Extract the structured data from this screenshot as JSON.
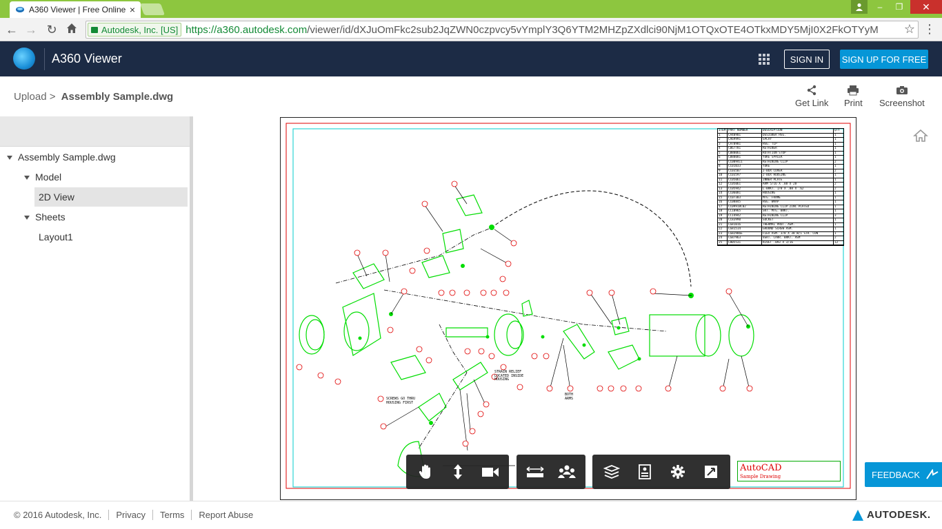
{
  "browser": {
    "tab_title": "A360 Viewer | Free Online",
    "tab_close": "×",
    "ev_label": "Autodesk, Inc. [US]",
    "url_host": "https://a360.autodesk.com",
    "url_path": "/viewer/id/dXJuOmFkc2sub2JqZWN0czpvcy5vYmplY3Q6YTM2MHZpZXdlci90NjM1OTQxOTE4OTkxMDY5MjI0X2FkOTYyM",
    "win_min": "–",
    "win_max": "❐",
    "win_close": "✕"
  },
  "header": {
    "app_title": "A360 Viewer",
    "sign_in": "SIGN IN",
    "sign_up": "SIGN UP FOR FREE"
  },
  "breadcrumb": {
    "root": "Upload",
    "separator": ">",
    "file": "Assembly Sample.dwg"
  },
  "actions": {
    "get_link": "Get Link",
    "print": "Print",
    "screenshot": "Screenshot"
  },
  "tree": {
    "root": "Assembly Sample.dwg",
    "model": "Model",
    "view_2d": "2D View",
    "sheets": "Sheets",
    "layout1": "Layout1"
  },
  "drawing": {
    "bom_header": [
      "ITEM",
      "PART NUMBER",
      "DESCRIPTION",
      "QTY"
    ],
    "bom_rows": [
      [
        "1",
        "CA40901",
        "DESIGNER HSG.",
        "1"
      ],
      [
        "2",
        "CA69991",
        "SPLAY",
        "1"
      ],
      [
        "3",
        "CA70981",
        "HSG. TIP",
        "1"
      ],
      [
        "4",
        "CB67781",
        "RETAINER",
        "1"
      ],
      [
        "5",
        "CB80061",
        "ROTATION STOP",
        "1"
      ],
      [
        "6",
        "CB80081",
        "YOKE SPACER",
        "1"
      ],
      [
        "7",
        "CC009411",
        "RETAINING CLIP",
        "2"
      ],
      [
        "8",
        "CC01033",
        "YOKE",
        "1"
      ],
      [
        "9",
        "CC03507",
        "J-BOX COVER",
        "2"
      ],
      [
        "10",
        "CC03597",
        "J-BOX HOUSING",
        "1"
      ],
      [
        "11",
        "CC05061",
        "INNER PLATE",
        "1"
      ],
      [
        "12",
        "CC05061",
        "ARM 5/16 X .88 X 28",
        "2"
      ],
      [
        "13",
        "CC05942",
        "L-BRKT. 1/8 X .88 X .62",
        "2"
      ],
      [
        "14",
        "CC06081",
        "HOUSING",
        "1"
      ],
      [
        "15",
        "CC07383",
        "MTG. FRAME",
        "1"
      ],
      [
        "16",
        "CC08845",
        "HSG. WRAP",
        "1"
      ],
      [
        "17",
        "CC09918C02",
        "RETAINING CLIP ZINC PLATED",
        "1"
      ],
      [
        "18",
        "CC10965",
        "SKT. MTG. BRKT.",
        "1"
      ],
      [
        "19",
        "CC14942",
        "RETAINING CLIP",
        "3"
      ],
      [
        "20",
        "CC83990",
        "SOCKET",
        "1"
      ],
      [
        "21",
        "CG81016",
        "THERMAL PROT. ASM.",
        "1"
      ],
      [
        "22",
        "CG81514",
        "GROUND SCREW ASM.",
        "1"
      ],
      [
        "23",
        "CG82986E",
        "FLEX ASM. 3/8 X 38 W/1 STR. CON",
        "1"
      ],
      [
        "24",
        "CG87963",
        "VERT. CARR. BRKT. ASM",
        "2"
      ],
      [
        "25",
        "CH05531",
        "RIVET .093 X 3/16",
        "12"
      ]
    ],
    "note_strain": "STRAIN RELIEF\nLOCATED INSIDE\nHOUSING",
    "note_screws": "SCREWS GO THRU\nHOUSING FIRST",
    "note_both": "BOTH\nARMS",
    "title_main": "AutoCAD",
    "title_sub": "Sample Drawing"
  },
  "feedback": "FEEDBACK",
  "footer": {
    "copyright": "© 2016 Autodesk, Inc.",
    "privacy": "Privacy",
    "terms": "Terms",
    "report": "Report Abuse",
    "brand": "AUTODESK."
  },
  "colors": {
    "chrome_green": "#8dc63f",
    "header_navy": "#1c2b45",
    "accent_blue": "#0696d7",
    "drawing_green": "#00dd00",
    "border_red": "#e00000",
    "border_cyan": "#00cccc"
  },
  "icons": [
    "back-icon",
    "forward-icon",
    "reload-icon",
    "home-icon",
    "star-icon",
    "apps-grid-icon",
    "share-icon",
    "printer-icon",
    "camera-icon",
    "pan-icon",
    "zoom-icon",
    "camera-view-icon",
    "measure-icon",
    "explode-icon",
    "layers-icon",
    "properties-icon",
    "settings-icon",
    "fullscreen-icon"
  ]
}
